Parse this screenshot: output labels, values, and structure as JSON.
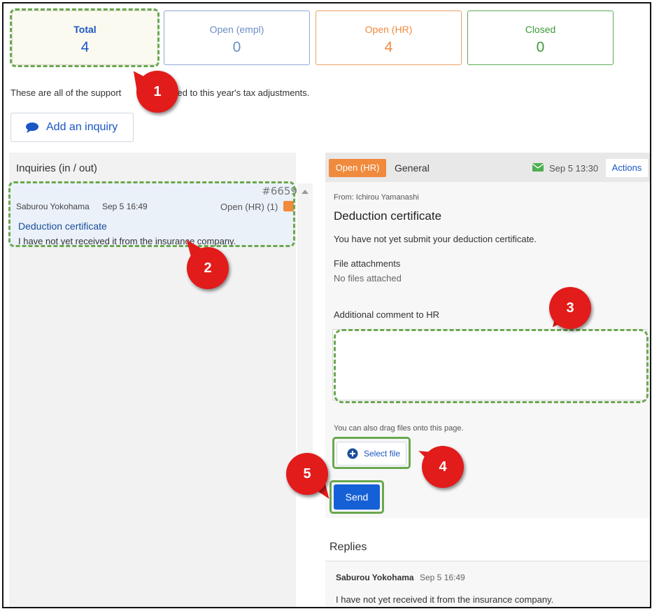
{
  "summary": {
    "cards": [
      {
        "label": "Total",
        "value": "4"
      },
      {
        "label": "Open (empl)",
        "value": "0"
      },
      {
        "label": "Open (HR)",
        "value": "4"
      },
      {
        "label": "Closed",
        "value": "0"
      }
    ],
    "description_pre": "These are all of the support",
    "description_post": "elated to this year's tax adjustments."
  },
  "add_inquiry_label": "Add an inquiry",
  "inquiries": {
    "heading": "Inquiries (in / out)",
    "items": [
      {
        "id": "#6659",
        "author": "Saburou Yokohama",
        "date": "Sep 5 16:49",
        "status": "Open (HR) (1)",
        "title": "Deduction certificate",
        "snippet": "I have not yet received it from the insurance company."
      }
    ]
  },
  "detail": {
    "status_badge": "Open (HR)",
    "category": "General",
    "timestamp": "Sep 5 13:30",
    "actions_label": "Actions",
    "from": "From: Ichirou Yamanashi",
    "title": "Deduction certificate",
    "message": "You have not yet submit your deduction certificate.",
    "attachments_label": "File attachments",
    "attachments_value": "No files attached",
    "comment_label": "Additional comment to HR",
    "comment_value": "",
    "drag_hint": "You can also drag files onto this page.",
    "select_file_label": "Select file",
    "send_label": "Send"
  },
  "replies": {
    "heading": "Replies",
    "items": [
      {
        "author": "Saburou Yokohama",
        "date": "Sep 5 16:49",
        "text": "I have not yet received it from the insurance company."
      }
    ]
  },
  "callouts": [
    "1",
    "2",
    "3",
    "4",
    "5"
  ],
  "colors": {
    "total": "#1a56c4",
    "open_empl": "#6b8fc7",
    "open_hr": "#f08a3c",
    "closed": "#3f9a3a",
    "highlight": "#6aa84f",
    "callout": "#e21b1b",
    "primary": "#1560d6",
    "link": "#1a56c4"
  }
}
